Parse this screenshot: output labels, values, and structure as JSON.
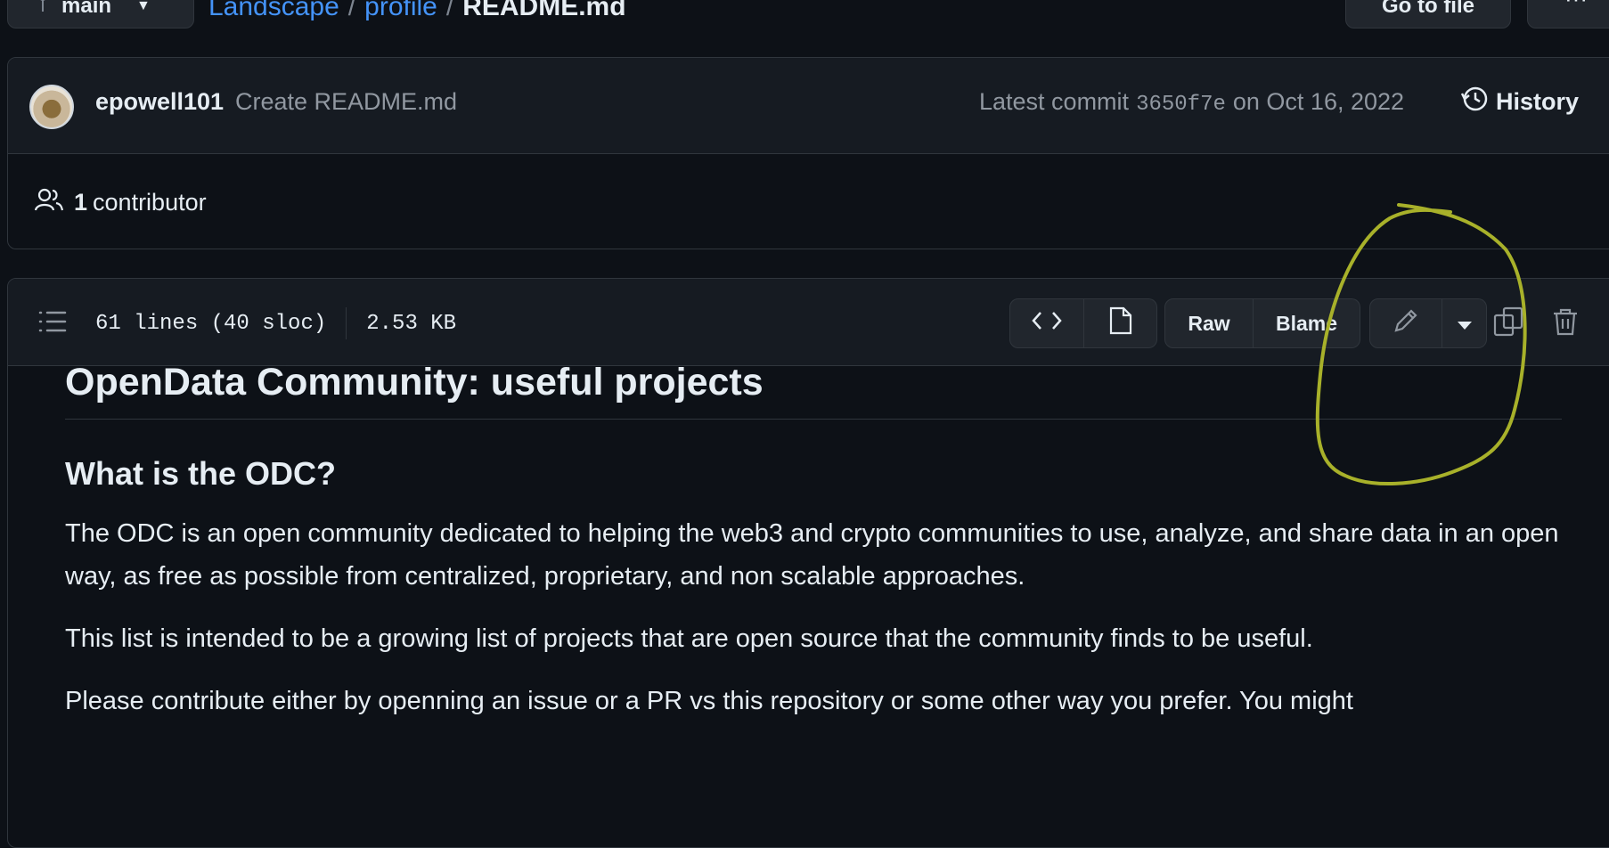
{
  "top_bar": {
    "branch": "main",
    "breadcrumb": {
      "org": "Landscape",
      "repo": "profile",
      "file": "README.md",
      "separator": "/"
    },
    "go_to_file": "Go to file",
    "more": "···"
  },
  "commit": {
    "author": "epowell101",
    "message": "Create README.md",
    "latest_label": "Latest commit",
    "sha": "3650f7e",
    "date": "on Oct 16, 2022",
    "history": "History"
  },
  "contributors": {
    "count": "1",
    "label": "contributor"
  },
  "file_header": {
    "lines": "61 lines (40 sloc)",
    "size": "2.53 KB",
    "raw": "Raw",
    "blame": "Blame"
  },
  "readme": {
    "h1": "OpenData Community: useful projects",
    "h2": "What is the ODC?",
    "p1": "The ODC is an open community dedicated to helping the web3 and crypto communities to use, analyze, and share data in an open way, as free as possible from centralized, proprietary, and non scalable approaches.",
    "p2": "This list is intended to be a growing list of projects that are open source that the community finds to be useful.",
    "p3": "Please contribute either by openning an issue or a PR vs this repository or some other way you prefer. You might"
  },
  "colors": {
    "background": "#0d1117",
    "link": "#4493f8",
    "annotation": "#a8b12a"
  }
}
